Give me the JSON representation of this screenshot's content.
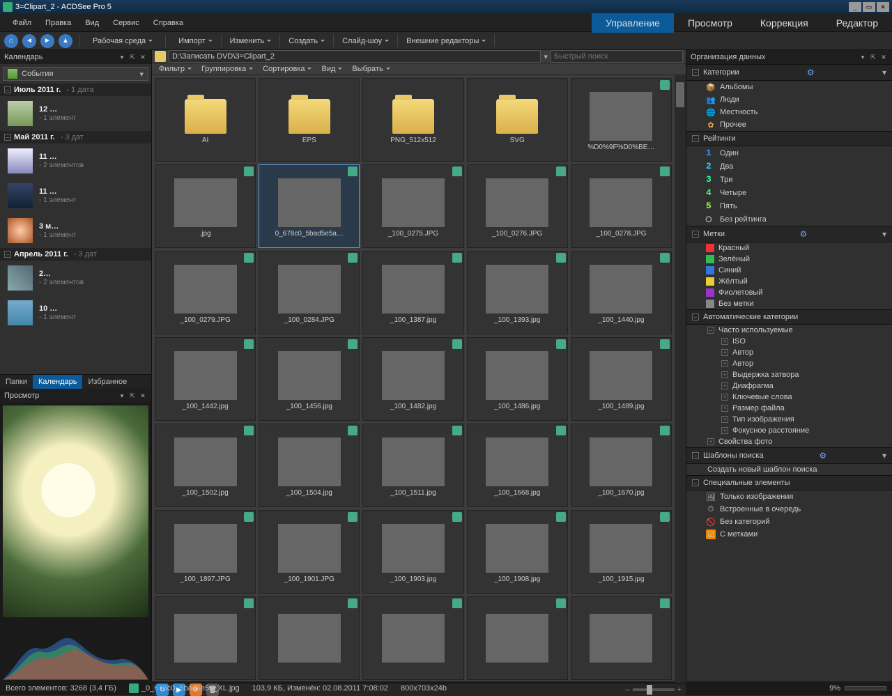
{
  "title": "3=Clipart_2 - ACDSee Pro 5",
  "menu": {
    "items": [
      "Файл",
      "Правка",
      "Вид",
      "Сервис",
      "Справка"
    ]
  },
  "modes": {
    "tabs": [
      "Управление",
      "Просмотр",
      "Коррекция",
      "Редактор"
    ],
    "active": 0
  },
  "toolbar": {
    "workspace": "Рабочая среда",
    "menus": [
      "Импорт",
      "Изменить",
      "Создать",
      "Слайд-шоу",
      "Внешние редакторы"
    ]
  },
  "left": {
    "calendar_title": "Календарь",
    "events_label": "События",
    "months": [
      {
        "name": "Июль 2011 г.",
        "dates": "- 1 дата",
        "items": [
          {
            "day": "12 …",
            "count": "- 1 элемент",
            "thumb": "tc9"
          }
        ]
      },
      {
        "name": "Май 2011 г.",
        "dates": "- 3 дат",
        "items": [
          {
            "day": "11 …",
            "count": "- 2 элементов",
            "thumb": "tc2"
          },
          {
            "day": "11 …",
            "count": "- 1 элемент",
            "thumb": "tc10"
          },
          {
            "day": "3 м…",
            "count": "- 1 элемент",
            "thumb": "tc6"
          }
        ]
      },
      {
        "name": "Апрель 2011 г.",
        "dates": "- 3 дат",
        "items": [
          {
            "day": "2…",
            "count": "- 2 элементов",
            "thumb": "tc1"
          },
          {
            "day": "10 …",
            "count": "- 1 элемент",
            "thumb": "tc13"
          }
        ]
      }
    ],
    "tabs": {
      "papki": "Папки",
      "kalendar": "Календарь",
      "izbrannoe": "Избранное"
    },
    "preview_title": "Просмотр"
  },
  "path": "D:\\Записать DVD\\3=Clipart_2",
  "search_placeholder": "Быстрый поиск",
  "filterbar": {
    "items": [
      "Фильтр",
      "Группировка",
      "Сортировка",
      "Вид",
      "Выбрать"
    ]
  },
  "thumbs": [
    {
      "label": "AI",
      "folder": true
    },
    {
      "label": "EPS",
      "folder": true
    },
    {
      "label": "PNG_512x512",
      "folder": true
    },
    {
      "label": "SVG",
      "folder": true
    },
    {
      "label": "%D0%9F%D0%BE…",
      "cls": "tc2"
    },
    {
      "label": ".jpg",
      "cls": "tc4"
    },
    {
      "label": "0_678c0_5bad5e5a…",
      "cls": "tc7",
      "selected": true
    },
    {
      "label": "_100_0275.JPG",
      "cls": "tc10"
    },
    {
      "label": "_100_0276.JPG",
      "cls": "tc10"
    },
    {
      "label": "_100_0278.JPG",
      "cls": "tc14"
    },
    {
      "label": "_100_0279.JPG",
      "cls": "tc5"
    },
    {
      "label": "_100_0284.JPG",
      "cls": "tc12"
    },
    {
      "label": "_100_1387.jpg",
      "cls": "tc6"
    },
    {
      "label": "_100_1393.jpg",
      "cls": "tc9"
    },
    {
      "label": "_100_1440.jpg",
      "cls": "tc13"
    },
    {
      "label": "_100_1442.jpg",
      "cls": "tc2"
    },
    {
      "label": "_100_1456.jpg",
      "cls": "tc8"
    },
    {
      "label": "_100_1482.jpg",
      "cls": "tc12"
    },
    {
      "label": "_100_1486.jpg",
      "cls": "tc12"
    },
    {
      "label": "_100_1489.jpg",
      "cls": "tc11"
    },
    {
      "label": "_100_1502.jpg",
      "cls": "tc14"
    },
    {
      "label": "_100_1504.jpg",
      "cls": "tc1"
    },
    {
      "label": "_100_1511.jpg",
      "cls": "tc4"
    },
    {
      "label": "_100_1668.jpg",
      "cls": "tc11"
    },
    {
      "label": "_100_1670.jpg",
      "cls": "tc6"
    },
    {
      "label": "_100_1897.JPG",
      "cls": "tc8"
    },
    {
      "label": "_100_1901.JPG",
      "cls": "tc8"
    },
    {
      "label": "_100_1903.jpg",
      "cls": "tc9"
    },
    {
      "label": "_100_1908.jpg",
      "cls": "tc9"
    },
    {
      "label": "_100_1915.jpg",
      "cls": "tc4"
    },
    {
      "label": " ",
      "cls": "tc11"
    },
    {
      "label": " ",
      "cls": "tc9"
    },
    {
      "label": " ",
      "cls": "tc6"
    },
    {
      "label": " ",
      "cls": "tc14"
    },
    {
      "label": " ",
      "cls": "tc9"
    }
  ],
  "right": {
    "title": "Организация данных",
    "categories": {
      "title": "Категории",
      "items": [
        {
          "icon": "📦",
          "label": "Альбомы",
          "color": "#5bc"
        },
        {
          "icon": "👥",
          "label": "Люди",
          "color": "#e95"
        },
        {
          "icon": "🌐",
          "label": "Местность",
          "color": "#5cb"
        },
        {
          "icon": "✿",
          "label": "Прочее",
          "color": "#ea5"
        }
      ]
    },
    "ratings": {
      "title": "Рейтинги",
      "items": [
        "Один",
        "Два",
        "Три",
        "Четыре",
        "Пять"
      ],
      "none": "Без рейтинга"
    },
    "labels": {
      "title": "Метки",
      "items": [
        {
          "color": "#e33",
          "label": "Красный"
        },
        {
          "color": "#3b5",
          "label": "Зелёный"
        },
        {
          "color": "#37d",
          "label": "Синий"
        },
        {
          "color": "#ec3",
          "label": "Жёлтый"
        },
        {
          "color": "#93c",
          "label": "Фиолетовый"
        }
      ],
      "none": "Без метки"
    },
    "autocat": {
      "title": "Автоматические категории",
      "freq": "Часто используемые",
      "items": [
        "ISO",
        "Автор",
        "Автор",
        "Выдержка затвора",
        "Диафрагма",
        "Ключевые слова",
        "Размер файла",
        "Тип изображения",
        "Фокусное расстояние"
      ],
      "props": "Свойства фото"
    },
    "templates": {
      "title": "Шаблоны поиска",
      "create": "Создать новый шаблон поиска"
    },
    "special": {
      "title": "Специальные элементы",
      "items": [
        {
          "icon": "🖼",
          "label": "Только изображения"
        },
        {
          "icon": "⏱",
          "label": "Встроенные в очередь"
        },
        {
          "icon": "🚫",
          "label": "Без категорий"
        },
        {
          "icon": "☑",
          "label": "С метками",
          "color": "#e80"
        }
      ]
    }
  },
  "status": {
    "total": "Всего элементов: 3268  (3,4 ГБ)",
    "file": "_0_678c0_5bad5e5a_XL.jpg",
    "details": "103,9 КБ, Изменён: 02.08.2011 7:08:02",
    "dims": "800x703x24b",
    "pct": "9%"
  }
}
